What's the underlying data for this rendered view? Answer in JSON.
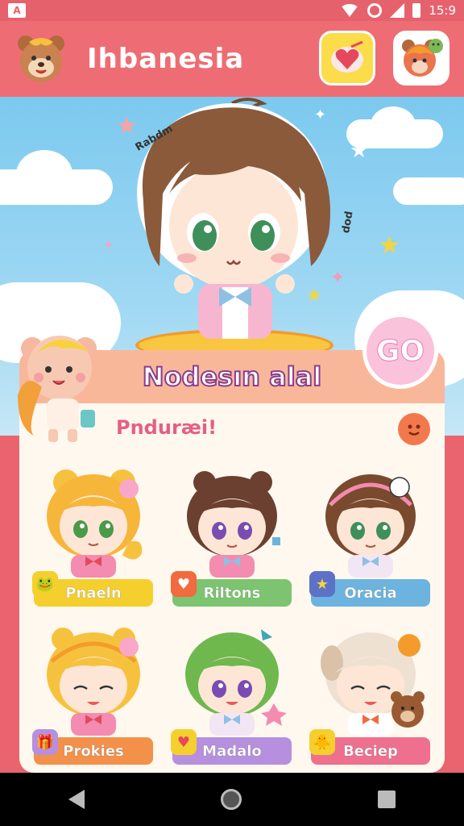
{
  "status_bar": {
    "left_badge": "A",
    "time": "15:9"
  },
  "app": {
    "title": "Ihbanesia"
  },
  "hero": {
    "left_caption": "Rabdm",
    "right_caption": "dod"
  },
  "card": {
    "title": "Nodesın alal",
    "subtitle": "Pnduræi!",
    "go_button": "GO"
  },
  "characters": [
    {
      "label": "Pnaeln",
      "color": "#f5cf2d"
    },
    {
      "label": "Riltons",
      "color": "#7cc46f"
    },
    {
      "label": "Oracia",
      "color": "#6cb3df"
    },
    {
      "label": "Prokies",
      "color": "#f3914a"
    },
    {
      "label": "Madalo",
      "color": "#b690de"
    },
    {
      "label": "Beciep",
      "color": "#ef6f8f"
    }
  ],
  "colors": {
    "header": "#ee6d74",
    "status": "#e5626c",
    "card": "#fff8ef",
    "accent_pink": "#e55f84"
  },
  "icons": {
    "fav": "heart-letter-icon",
    "profile": "bear-profile-icon",
    "logo": "bear-logo-icon"
  }
}
